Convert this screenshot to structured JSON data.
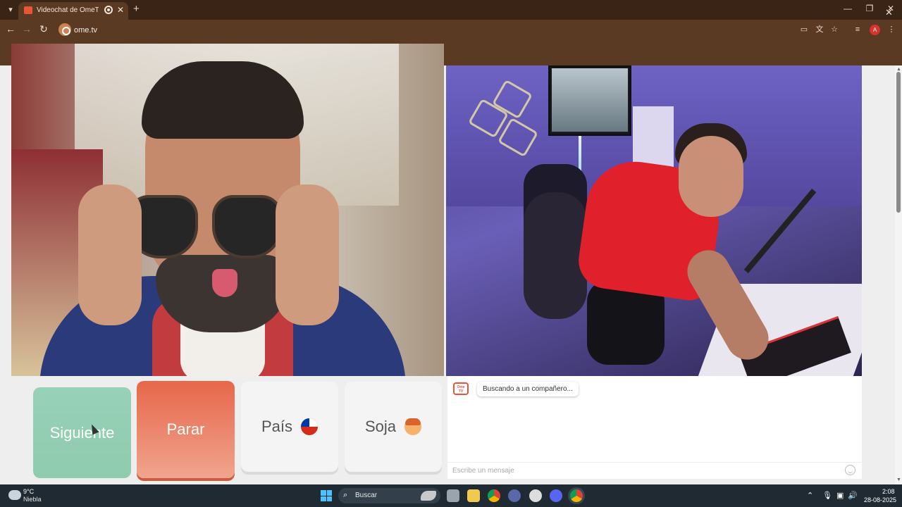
{
  "browser": {
    "tab_title": "Videochat de OmeTV: uno",
    "url": "ome.tv",
    "profile_initial": "A"
  },
  "controls": {
    "next_label": "Siguiente",
    "stop_label": "Parar",
    "country_label": "País",
    "gender_label": "Soja"
  },
  "chat": {
    "logo_text": "Ome TV",
    "status_message": "Buscando a un compañero...",
    "input_placeholder": "Escribe un mensaje"
  },
  "taskbar": {
    "weather_temp": "9°C",
    "weather_desc": "Niebla",
    "search_label": "Buscar",
    "time": "2:08",
    "date": "28-08-2025"
  },
  "icons": {
    "country_flag": "chile-flag",
    "gender_icon": "boy-face-emoji"
  },
  "colors": {
    "next_button": "#97d1b8",
    "stop_button": "#e7674a",
    "brand": "#e8563a",
    "browser_frame": "#5a3a22"
  }
}
